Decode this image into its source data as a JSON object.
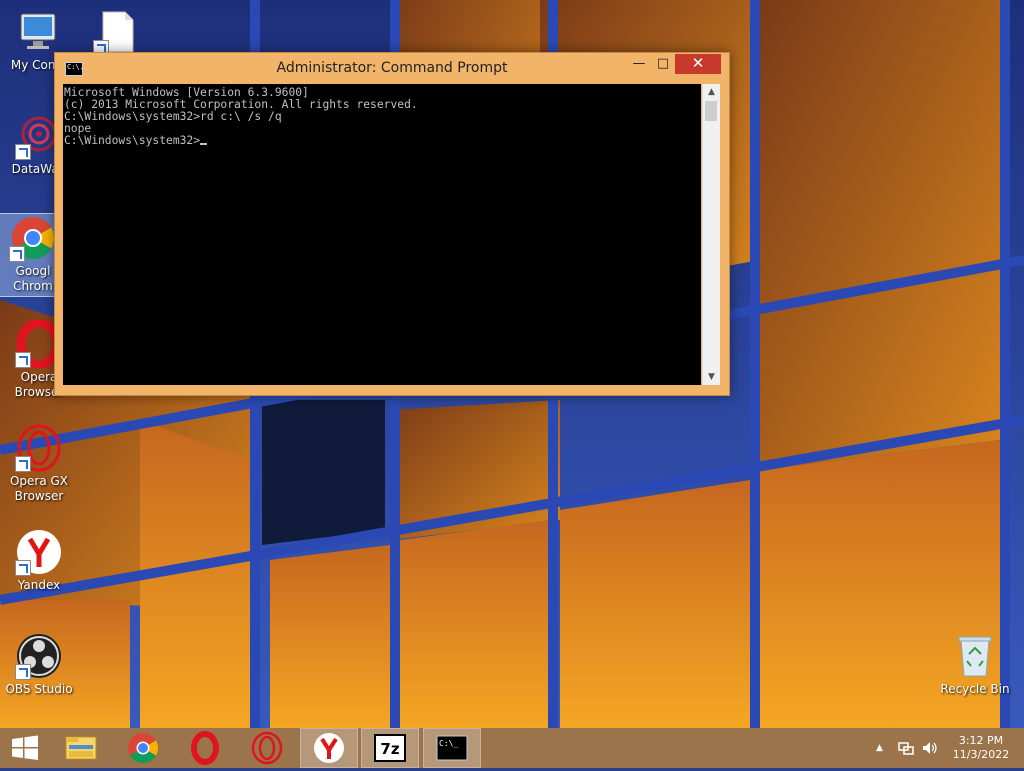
{
  "desktop": {
    "icons": [
      {
        "label": "My Comp",
        "icon": "computer-icon"
      },
      {
        "label": "",
        "icon": "file-icon"
      },
      {
        "label": "DataWag",
        "icon": "datawag-icon"
      },
      {
        "label": "Googl\nChrom",
        "icon": "chrome-icon"
      },
      {
        "label": "Opera\nBrowser",
        "icon": "opera-icon"
      },
      {
        "label": "Opera GX\nBrowser",
        "icon": "opera-gx-icon"
      },
      {
        "label": "Yandex",
        "icon": "yandex-icon"
      },
      {
        "label": "OBS Studio",
        "icon": "obs-icon"
      },
      {
        "label": "Recycle Bin",
        "icon": "recycle-bin-icon"
      }
    ]
  },
  "window": {
    "title": "Administrator: Command Prompt",
    "icon_text": "C:\\.",
    "minimize": "—",
    "maximize": "□",
    "close": "✕",
    "console_lines": [
      "Microsoft Windows [Version 6.3.9600]",
      "(c) 2013 Microsoft Corporation. All rights reserved.",
      "C:\\Windows\\system32>rd c:\\ /s /q",
      "nope",
      "",
      "C:\\Windows\\system32>"
    ]
  },
  "taskbar": {
    "items": [
      {
        "name": "start",
        "icon": "windows-start-icon"
      },
      {
        "name": "file-explorer",
        "icon": "folder-icon"
      },
      {
        "name": "chrome",
        "icon": "chrome-icon"
      },
      {
        "name": "opera",
        "icon": "opera-icon"
      },
      {
        "name": "opera-gx",
        "icon": "opera-gx-icon"
      },
      {
        "name": "yandex",
        "icon": "yandex-icon"
      },
      {
        "name": "7zip",
        "icon": "7zip-icon",
        "text": "7z"
      },
      {
        "name": "cmd",
        "icon": "cmd-icon",
        "text": "C:\\_"
      }
    ],
    "clock": {
      "time": "3:12 PM",
      "date": "11/3/2022"
    }
  },
  "colors": {
    "window_frame": "#f1b469",
    "close_button": "#c7392d",
    "console_bg": "#000000",
    "console_text": "#c0c0c0"
  }
}
